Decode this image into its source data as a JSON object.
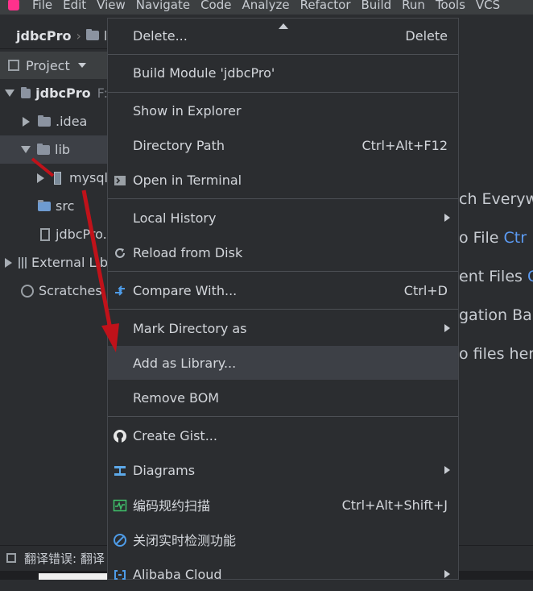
{
  "menubar": {
    "items": [
      "File",
      "Edit",
      "View",
      "Navigate",
      "Code",
      "Analyze",
      "Refactor",
      "Build",
      "Run",
      "Tools",
      "VCS"
    ]
  },
  "navbar": {
    "project": "jdbcPro",
    "next": "l"
  },
  "project_panel": {
    "title": "Project"
  },
  "tree": {
    "root": "jdbcPro",
    "root_suffix": "F:",
    "idea": ".idea",
    "lib": "lib",
    "jar": "mysql",
    "src": "src",
    "iml": "jdbcPro.",
    "external": "External Lib",
    "scratches": "Scratches"
  },
  "editor_hints": {
    "l1": "ch Everyw",
    "l2a": "o File ",
    "l2b": "Ctr",
    "l3a": "ent Files ",
    "l3b": "C",
    "l4": "gation Ba",
    "l5": "o files here"
  },
  "context_menu": {
    "delete": {
      "label": "Delete...",
      "shortcut": "Delete"
    },
    "build_module": {
      "label": "Build Module 'jdbcPro'"
    },
    "show_explorer": {
      "label": "Show in Explorer"
    },
    "directory_path": {
      "label": "Directory Path",
      "shortcut": "Ctrl+Alt+F12"
    },
    "open_terminal": {
      "label": "Open in Terminal"
    },
    "local_history": {
      "label": "Local History"
    },
    "reload_disk": {
      "label": "Reload from Disk"
    },
    "compare_with": {
      "label": "Compare With...",
      "shortcut": "Ctrl+D"
    },
    "mark_directory": {
      "label": "Mark Directory as"
    },
    "add_library": {
      "label": "Add as Library..."
    },
    "remove_bom": {
      "label": "Remove BOM"
    },
    "create_gist": {
      "label": "Create Gist..."
    },
    "diagrams": {
      "label": "Diagrams"
    },
    "code_scan": {
      "label": "编码规约扫描",
      "shortcut": "Ctrl+Alt+Shift+J"
    },
    "close_detect": {
      "label": "关闭实时检测功能"
    },
    "alibaba_cloud": {
      "label": "Alibaba Cloud"
    }
  },
  "status": {
    "text": "翻译错误: 翻译"
  },
  "colors": {
    "arrow": "#c0121a",
    "accent": "#5c9cf5",
    "highlight": "#3d4046"
  }
}
